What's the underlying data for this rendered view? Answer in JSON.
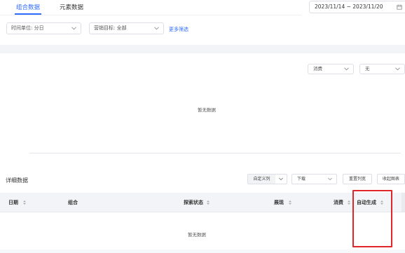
{
  "tabs": {
    "active_label": "组合数据",
    "inactive_label": "元素数据"
  },
  "date_range": {
    "value": "2023/11/14 ~ 2023/11/20",
    "icon": "calendar-icon"
  },
  "filters": {
    "time_unit": "时间单位: 分日",
    "marketing_goal": "营销目标: 全部",
    "more_filter": "更多筛选"
  },
  "chart": {
    "metric_select": "消费",
    "compare_select": "无",
    "empty_text": "暂无数据"
  },
  "details": {
    "title": "详细数据",
    "custom_columns": "自定义列",
    "download": "下载",
    "reset_width": "重置列宽",
    "collapse_chart": "收起图表",
    "columns": [
      "日期",
      "组合",
      "探索状态",
      "展现",
      "消费",
      "自动生成"
    ],
    "empty_text": "暂无数据"
  },
  "colors": {
    "accent": "#2f6bff",
    "highlight": "#e0262a"
  }
}
